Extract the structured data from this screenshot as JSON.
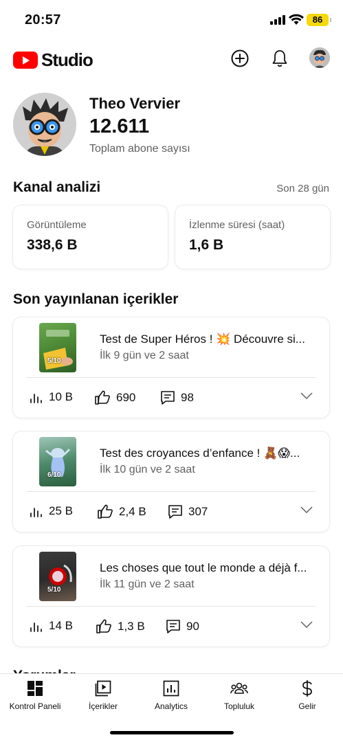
{
  "status_bar": {
    "time": "20:57",
    "battery": "86"
  },
  "header": {
    "app_name": "Studio",
    "create_icon": "add-circle-icon",
    "notifications_icon": "bell-icon"
  },
  "channel": {
    "name": "Theo Vervier",
    "subscribers": "12.611",
    "subscribers_label": "Toplam abone sayısı"
  },
  "analytics": {
    "title": "Kanal analizi",
    "period": "Son 28 gün",
    "metrics": [
      {
        "label": "Görüntüleme",
        "value": "338,6 B"
      },
      {
        "label": "İzlenme süresi (saat)",
        "value": "1,6 B"
      }
    ]
  },
  "recent": {
    "title": "Son yayınlanan içerikler",
    "videos": [
      {
        "title": "Test de Super Héros ! 💥 Découvre si...",
        "age": "İlk 9 gün ve 2 saat",
        "badge": "5/10",
        "views": "10 B",
        "likes": "690",
        "comments": "98"
      },
      {
        "title": "Test des croyances d’enfance ! 🧸😱...",
        "age": "İlk 10 gün ve 2 saat",
        "badge": "6/10",
        "views": "25 B",
        "likes": "2,4 B",
        "comments": "307"
      },
      {
        "title": "Les choses que tout le monde a déjà f...",
        "age": "İlk 11 gün ve 2 saat",
        "badge": "5/10",
        "views": "14 B",
        "likes": "1,3 B",
        "comments": "90"
      }
    ]
  },
  "next_section_peek": "Yorumlar",
  "nav": [
    {
      "label": "Kontrol Paneli",
      "icon": "dashboard-icon"
    },
    {
      "label": "İçerikler",
      "icon": "content-icon"
    },
    {
      "label": "Analytics",
      "icon": "analytics-icon"
    },
    {
      "label": "Topluluk",
      "icon": "community-icon"
    },
    {
      "label": "Gelir",
      "icon": "dollar-icon"
    }
  ],
  "colors": {
    "brand": "#ff0000",
    "battery": "#f5d90a",
    "secondary_text": "#606060"
  }
}
